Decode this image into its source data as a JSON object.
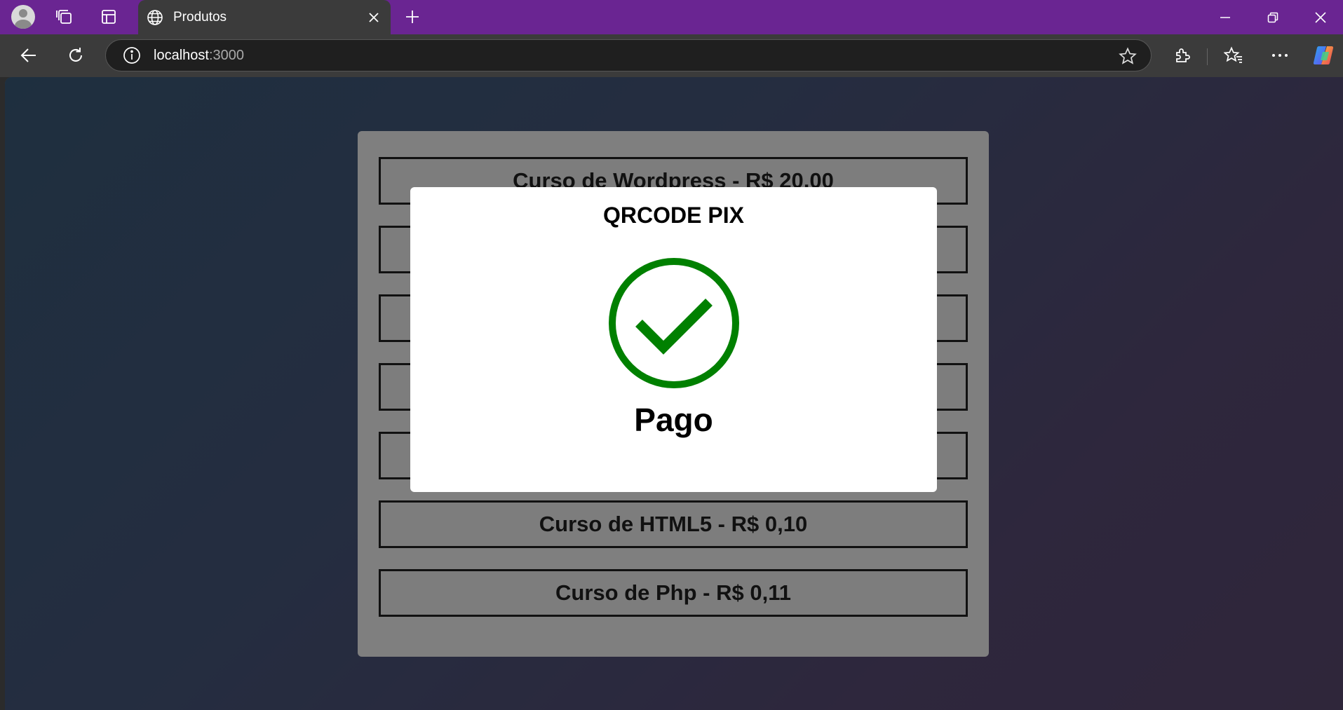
{
  "browser": {
    "tab_title": "Produtos",
    "url_host": "localhost",
    "url_port": ":3000"
  },
  "products": [
    {
      "label": "Curso de Wordpress - R$ 20,00"
    },
    {
      "label": ""
    },
    {
      "label": ""
    },
    {
      "label": ""
    },
    {
      "label": ""
    },
    {
      "label": "Curso de HTML5 - R$ 0,10"
    },
    {
      "label": "Curso de Php - R$ 0,11"
    }
  ],
  "modal": {
    "title": "QRCODE PIX",
    "status": "Pago",
    "status_icon": "check-circle-icon",
    "status_color": "#008000"
  }
}
